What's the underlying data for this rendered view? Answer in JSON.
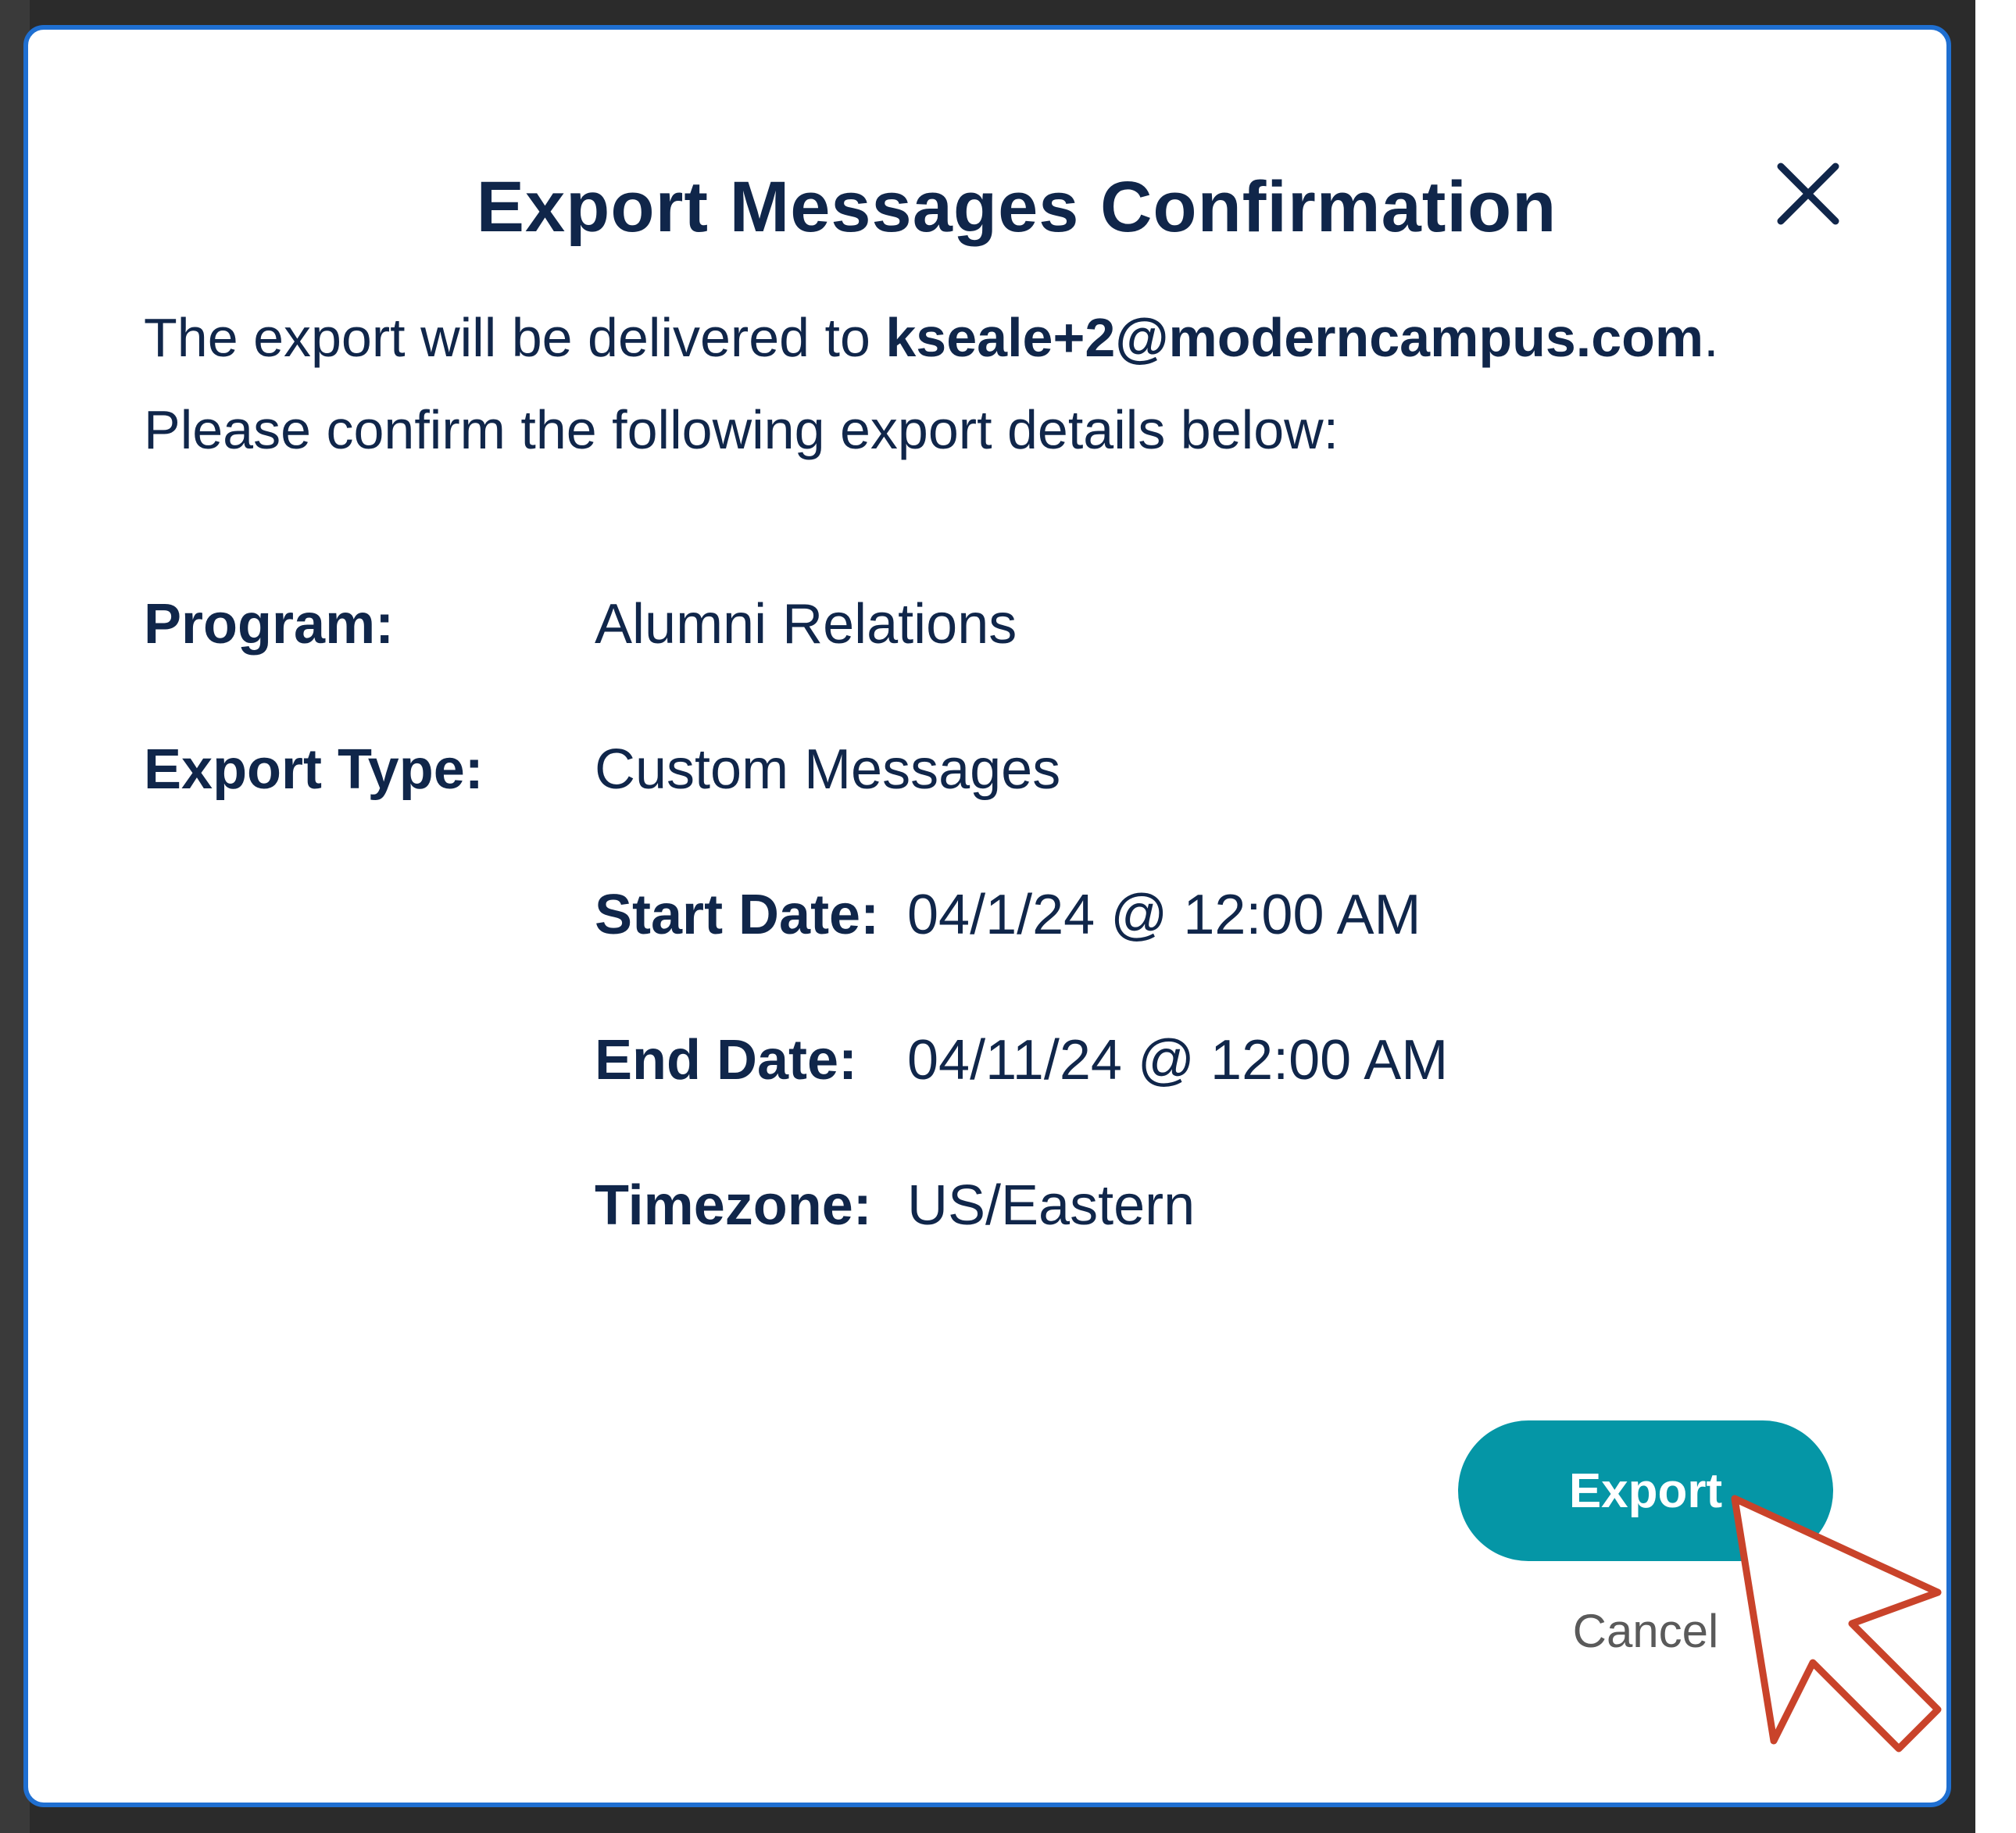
{
  "modal": {
    "title": "Export Messages Confirmation",
    "intro_prefix": "The export will be delivered to ",
    "email": "kseale+2@moderncampus.com",
    "intro_suffix": ".",
    "intro_line2": "Please confirm the following export details below:",
    "close_icon": "close-icon"
  },
  "details": {
    "program_label": "Program:",
    "program_value": "Alumni Relations",
    "export_type_label": "Export Type:",
    "export_type_value": "Custom Messages",
    "start_date_label": "Start Date:",
    "start_date_value": "04/1/24 @ 12:00 AM",
    "end_date_label": "End Date:",
    "end_date_value": "04/11/24 @ 12:00 AM",
    "timezone_label": "Timezone:",
    "timezone_value": "US/Eastern"
  },
  "actions": {
    "export_label": "Export",
    "cancel_label": "Cancel"
  },
  "colors": {
    "text": "#10264a",
    "accent": "#0596a6",
    "border": "#1f6fd1",
    "cursor_outline": "#c9432a"
  }
}
